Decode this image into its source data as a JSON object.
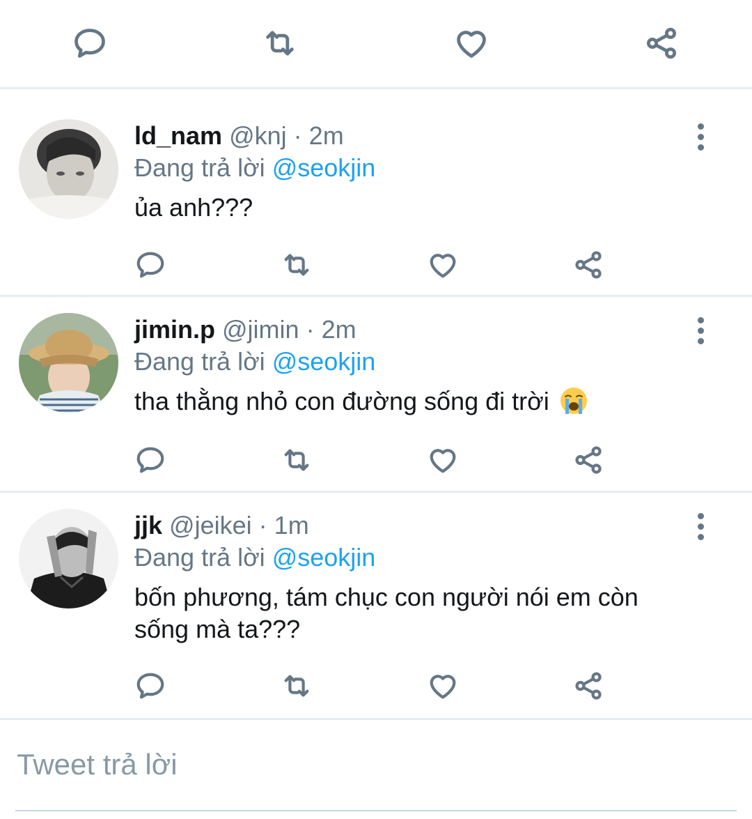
{
  "top_actions": {
    "icons": [
      "reply-icon",
      "retweet-icon",
      "like-icon",
      "share-icon"
    ]
  },
  "tweets": [
    {
      "name": "ld_nam",
      "handle": "@knj",
      "separator": "·",
      "time": "2m",
      "reply_prefix": "Đang trả lời",
      "reply_to": "@seokjin",
      "text": "ủa anh???",
      "avatar": "avatar-photo"
    },
    {
      "name": "jimin.p",
      "handle": "@jimin",
      "separator": "·",
      "time": "2m",
      "reply_prefix": "Đang trả lời",
      "reply_to": "@seokjin",
      "text": "tha thằng nhỏ con đường sống đi trời",
      "emoji": "loudly-crying-face-emoji",
      "avatar": "avatar-photo"
    },
    {
      "name": "jjk",
      "handle": "@jeikei",
      "separator": "·",
      "time": "1m",
      "reply_prefix": "Đang trả lời",
      "reply_to": "@seokjin",
      "text": "bốn phương, tám chục con người nói em còn sống mà ta???",
      "avatar": "avatar-photo"
    }
  ],
  "reply_box": {
    "placeholder": "Tweet trả lời"
  },
  "colors": {
    "text": "#14171a",
    "secondary": "#657786",
    "link": "#1da1f2",
    "divider": "#e6ecf0"
  }
}
